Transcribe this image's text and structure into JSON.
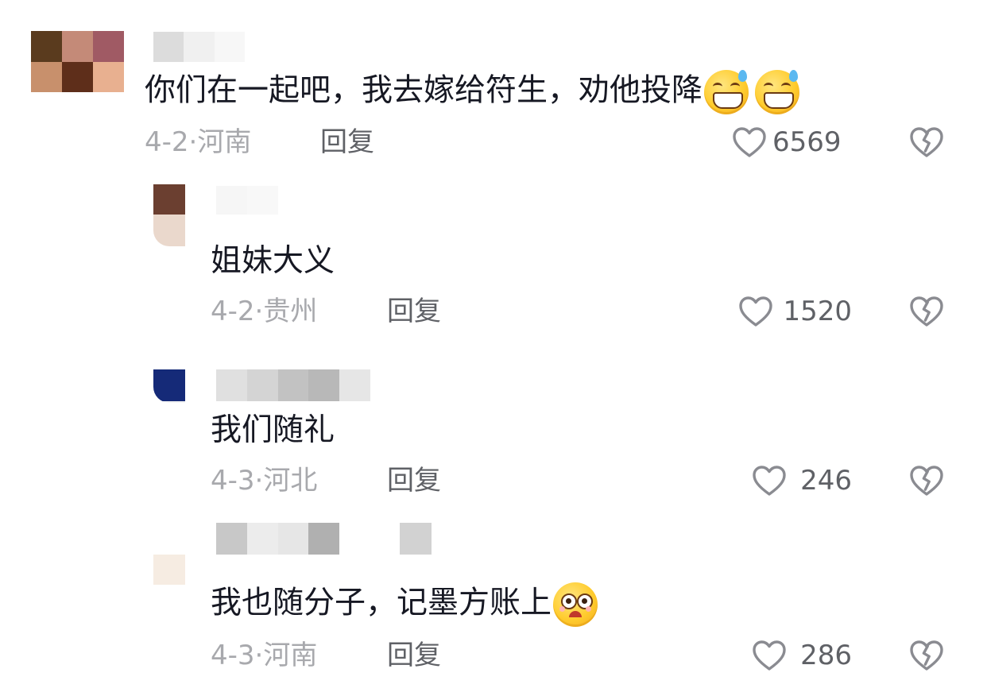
{
  "comments": [
    {
      "text": "你们在一起吧，我去嫁给符生，劝他投降",
      "emojis": [
        "grinning-sweat-emoji",
        "grinning-sweat-emoji"
      ],
      "date": "4-2",
      "separator": "·",
      "location": "河南",
      "reply_label": "回复",
      "likes": "6569",
      "avatar_colors": [
        "#5a3b1e",
        "#c48a78",
        "#a05a64",
        "#c8906c",
        "#5e2e1a",
        "#e8b090"
      ],
      "name_colors": [
        "#dcdcdc",
        "#f0f0f0",
        "#f7f7f7"
      ]
    },
    {
      "text": "姐妹大义",
      "date": "4-2",
      "separator": "·",
      "location": "贵州",
      "reply_label": "回复",
      "likes": "1520",
      "avatar_colors": [
        "#6b3f30",
        "#ead8cc"
      ],
      "name_colors": [
        "#f6f6f6",
        "#f8f8f8"
      ]
    },
    {
      "text": "我们随礼",
      "date": "4-3",
      "separator": "·",
      "location": "河北",
      "reply_label": "回复",
      "likes": "246",
      "avatar_colors": [
        "#152a78",
        "#f2f2f2"
      ],
      "name_colors": [
        "#e0e0e0",
        "#d4d4d4",
        "#c2c2c2",
        "#b8b8b8",
        "#e6e6e6",
        "#f4f4f4"
      ]
    },
    {
      "text": "我也随分子，记墨方账上",
      "emojis": [
        "pleading-face-emoji"
      ],
      "date": "4-3",
      "separator": "·",
      "location": "河南",
      "reply_label": "回复",
      "likes": "286",
      "avatar_colors": [
        "#f6ece2"
      ],
      "name_colors": [
        "#c8c8c8",
        "#ececec",
        "#e6e6e6",
        "#b0b0b0",
        "#d2d2d2"
      ]
    }
  ],
  "icons": {
    "like": "heart-outline-icon",
    "dislike": "broken-heart-icon"
  },
  "colors": {
    "text": "#161823",
    "meta": "#a8a9ad",
    "reply": "#5f6166",
    "icon": "#8a8b91"
  }
}
